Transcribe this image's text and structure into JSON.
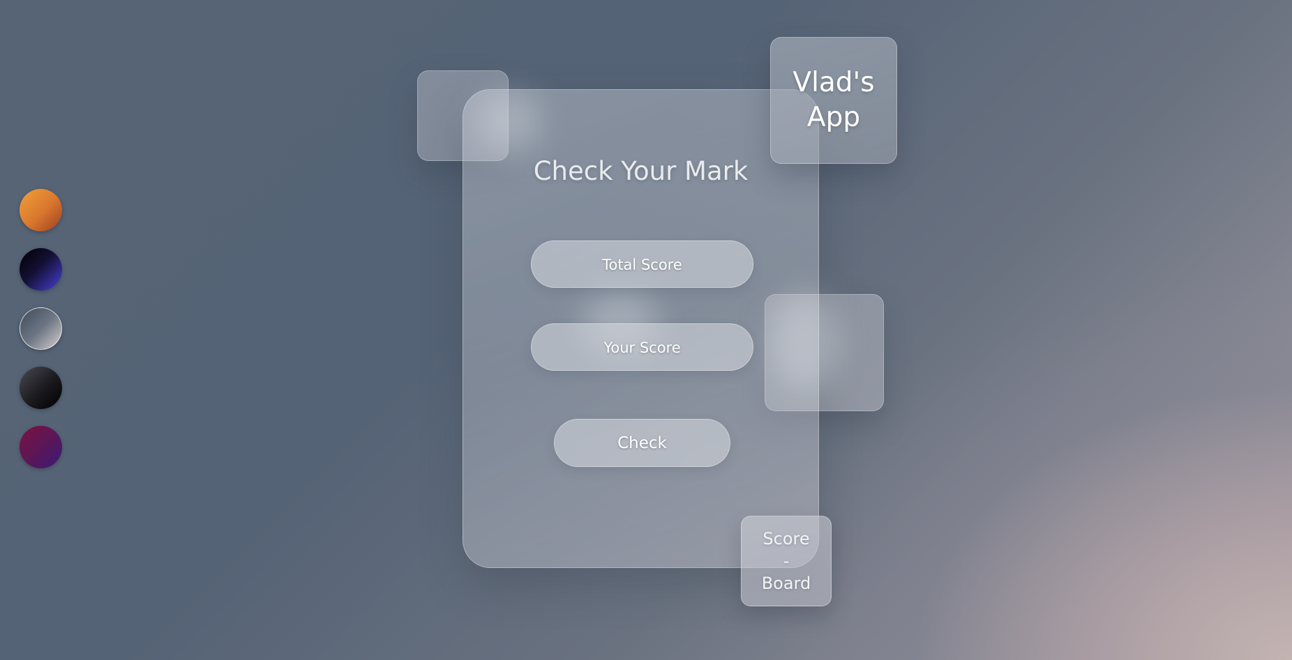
{
  "app": {
    "title_line1": "Vlad's",
    "title_line2": "App"
  },
  "theme_swatches": [
    {
      "name": "orange",
      "color": "#d9762d"
    },
    {
      "name": "blue-night",
      "color": "#4a40d8"
    },
    {
      "name": "slate",
      "color": "#6c7583"
    },
    {
      "name": "black",
      "color": "#1d1d22"
    },
    {
      "name": "purple",
      "color": "#5c1656"
    }
  ],
  "card": {
    "title": "Check Your Mark",
    "total_score_placeholder": "Total Score",
    "your_score_placeholder": "Your Score",
    "check_label": "Check"
  },
  "score_board": {
    "line1": "Score",
    "line2": "-",
    "line3": "Board"
  }
}
